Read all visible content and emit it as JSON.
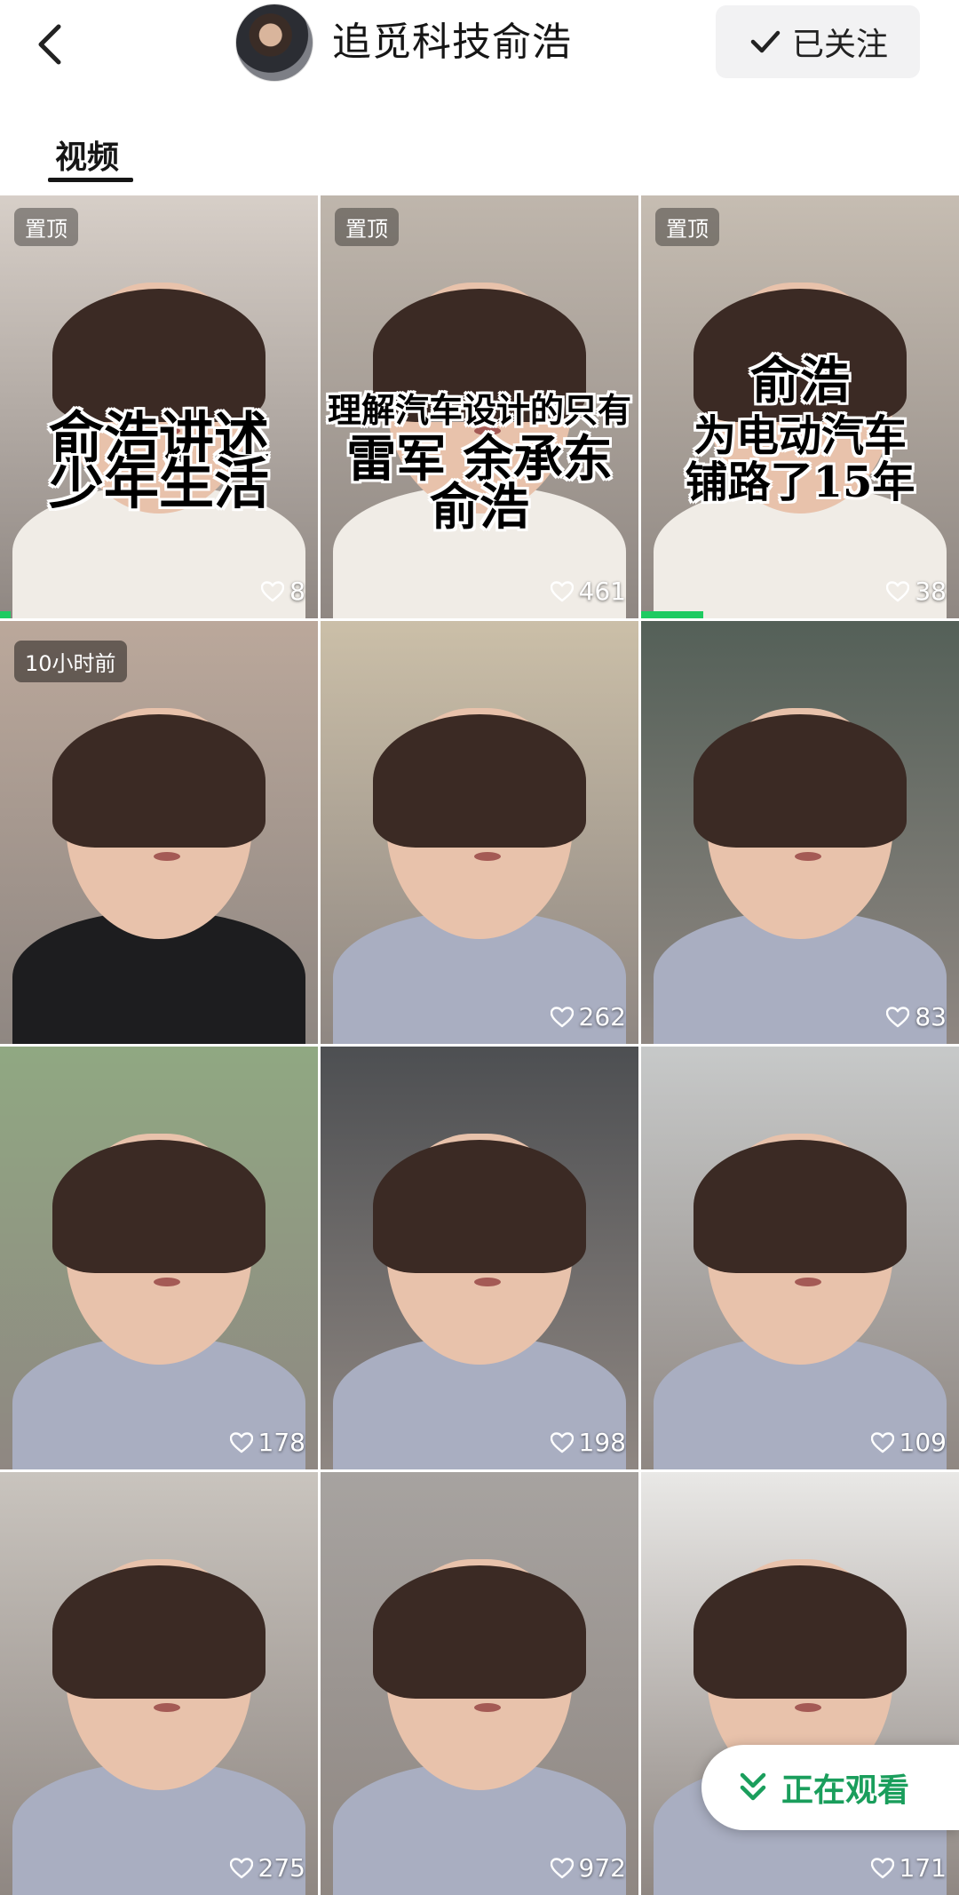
{
  "header": {
    "username": "追觅科技俞浩",
    "follow_label": "已关注"
  },
  "tabs": [
    {
      "label": "视频",
      "active": true
    }
  ],
  "videos": [
    {
      "badge": "置顶",
      "overlay": [
        "俞浩讲述",
        "少年生活"
      ],
      "likes": "8",
      "bg": "#d7cfc8"
    },
    {
      "badge": "置顶",
      "overlay": [
        "理解汽车设计的只有",
        "雷军  余承东",
        "俞浩"
      ],
      "likes": "461",
      "bg": "#bfb6ac"
    },
    {
      "badge": "置顶",
      "overlay": [
        "俞浩",
        "为电动汽车",
        "铺路了15年"
      ],
      "likes": "38",
      "bg": "#c6bdb2"
    },
    {
      "badge": "10小时前",
      "overlay": [],
      "likes": "",
      "bg": "#bba89b"
    },
    {
      "badge": "",
      "overlay": [],
      "likes": "262",
      "bg": "#cbbfa8"
    },
    {
      "badge": "",
      "overlay": [],
      "likes": "83",
      "bg": "#546058"
    },
    {
      "badge": "",
      "overlay": [],
      "likes": "178",
      "bg": "#90a882"
    },
    {
      "badge": "",
      "overlay": [],
      "likes": "198",
      "bg": "#4d4f52"
    },
    {
      "badge": "",
      "overlay": [],
      "likes": "109",
      "bg": "#c7c9c9"
    },
    {
      "badge": "",
      "overlay": [],
      "likes": "275",
      "bg": "#c9c4be"
    },
    {
      "badge": "",
      "overlay": [],
      "likes": "972",
      "bg": "#a7a3a0"
    },
    {
      "badge": "",
      "overlay": [],
      "likes": "171",
      "bg": "#e9e8e6"
    }
  ],
  "now_watching": {
    "label": "正在观看"
  },
  "colors": {
    "accent": "#1ecb61",
    "watching_text": "#1a9e5c"
  }
}
